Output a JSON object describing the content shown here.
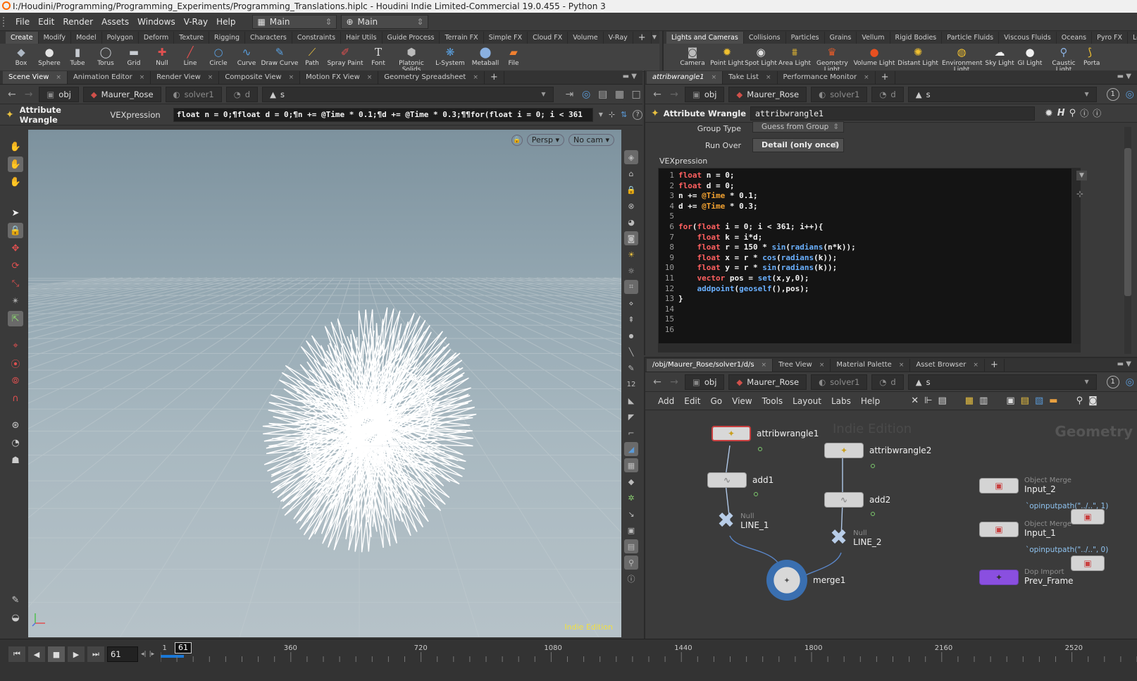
{
  "window": {
    "title": "I:/Houdini/Programming/Programming_Experiments/Programming_Translations.hiplc - Houdini Indie Limited-Commercial 19.0.455 - Python 3"
  },
  "menu": [
    "File",
    "Edit",
    "Render",
    "Assets",
    "Windows",
    "V-Ray",
    "Help"
  ],
  "desktop": {
    "label1": "Main",
    "label2": "Main"
  },
  "shelf_left": {
    "tabs": [
      "Create",
      "Modify",
      "Model",
      "Polygon",
      "Deform",
      "Texture",
      "Rigging",
      "Characters",
      "Constraints",
      "Hair Utils",
      "Guide Process",
      "Terrain FX",
      "Simple FX",
      "Cloud FX",
      "Volume",
      "V-Ray"
    ],
    "tools": [
      "Box",
      "Sphere",
      "Tube",
      "Torus",
      "Grid",
      "Null",
      "Line",
      "Circle",
      "Curve",
      "Draw Curve",
      "Path",
      "Spray Paint",
      "Font",
      "Platonic Solids",
      "L-System",
      "Metaball",
      "File"
    ]
  },
  "shelf_right": {
    "tabs": [
      "Lights and Cameras",
      "Collisions",
      "Particles",
      "Grains",
      "Vellum",
      "Rigid Bodies",
      "Particle Fluids",
      "Viscous Fluids",
      "Oceans",
      "Pyro FX",
      "Legacy Pyro"
    ],
    "tools": [
      "Camera",
      "Point Light",
      "Spot Light",
      "Area Light",
      "Geometry Light",
      "Volume Light",
      "Distant Light",
      "Environment Light",
      "Sky Light",
      "GI Light",
      "Caustic Light",
      "Porta"
    ]
  },
  "viewer": {
    "tabs": [
      "Scene View",
      "Animation Editor",
      "Render View",
      "Composite View",
      "Motion FX View",
      "Geometry Spreadsheet"
    ],
    "path": [
      "obj",
      "Maurer_Rose",
      "solver1",
      "d",
      "s"
    ],
    "op_label": "Attribute Wrangle",
    "vex_label": "VEXpression",
    "vex_oneline": "float n = 0;¶float d = 0;¶n += @Time * 0.1;¶d += @Time * 0.3;¶¶for(float i = 0; i < 361",
    "persp": "Persp",
    "cam": "No cam",
    "watermark": "Indie Edition"
  },
  "params": {
    "tabs": [
      "attribwrangle1",
      "Take List",
      "Performance Monitor"
    ],
    "path": [
      "obj",
      "Maurer_Rose",
      "solver1",
      "d",
      "s"
    ],
    "header_type": "Attribute Wrangle",
    "node_name": "attribwrangle1",
    "group_type_label": "Group Type",
    "group_type_value": "Guess from Group",
    "run_over_label": "Run Over",
    "run_over_value": "Detail (only once)",
    "vex_label": "VEXpression",
    "code": [
      "float n = 0;",
      "float d = 0;",
      "n += @Time * 0.1;",
      "d += @Time * 0.3;",
      "",
      "for(float i = 0; i < 361; i++){",
      "    float k = i*d;",
      "    float r = 150 * sin(radians(n*k));",
      "    float x = r * cos(radians(k));",
      "    float y = r * sin(radians(k));",
      "    vector pos = set(x,y,0);",
      "    addpoint(geoself(),pos);",
      "}",
      "",
      "",
      ""
    ]
  },
  "network": {
    "tabs": [
      "/obj/Maurer_Rose/solver1/d/s",
      "Tree View",
      "Material Palette",
      "Asset Browser"
    ],
    "path": [
      "obj",
      "Maurer_Rose",
      "solver1",
      "d",
      "s"
    ],
    "menu": [
      "Add",
      "Edit",
      "Go",
      "View",
      "Tools",
      "Layout",
      "Labs",
      "Help"
    ],
    "watermark_indie": "Indie Edition",
    "watermark_ctx": "Geometry",
    "nodes": {
      "aw1": "attribwrangle1",
      "aw2": "attribwrangle2",
      "add1": "add1",
      "add2": "add2",
      "line1": "LINE_1",
      "line2": "LINE_2",
      "null1_type": "Null",
      "null2_type": "Null",
      "merge": "merge1",
      "in2_type": "Object Merge",
      "in2": "Input_2",
      "in2_expr": "`opinputpath(\"../..\", 1)",
      "in1_type": "Object Merge",
      "in1": "Input_1",
      "in1_expr": "`opinputpath(\"../..\", 0)",
      "dop_type": "Dop Import",
      "dop": "Prev_Frame"
    }
  },
  "timeline": {
    "frame": "61",
    "marker": "61",
    "ticks": [
      "1",
      "360",
      "720",
      "1080",
      "1440",
      "1800",
      "2160",
      "2520"
    ],
    "progress": 0.024
  },
  "colors": {
    "accent": "#ff6a00",
    "rose": "#ffffff",
    "timebar": "#1a78d8",
    "merge": "#3a6fb0",
    "dop": "#8a4fe0"
  }
}
